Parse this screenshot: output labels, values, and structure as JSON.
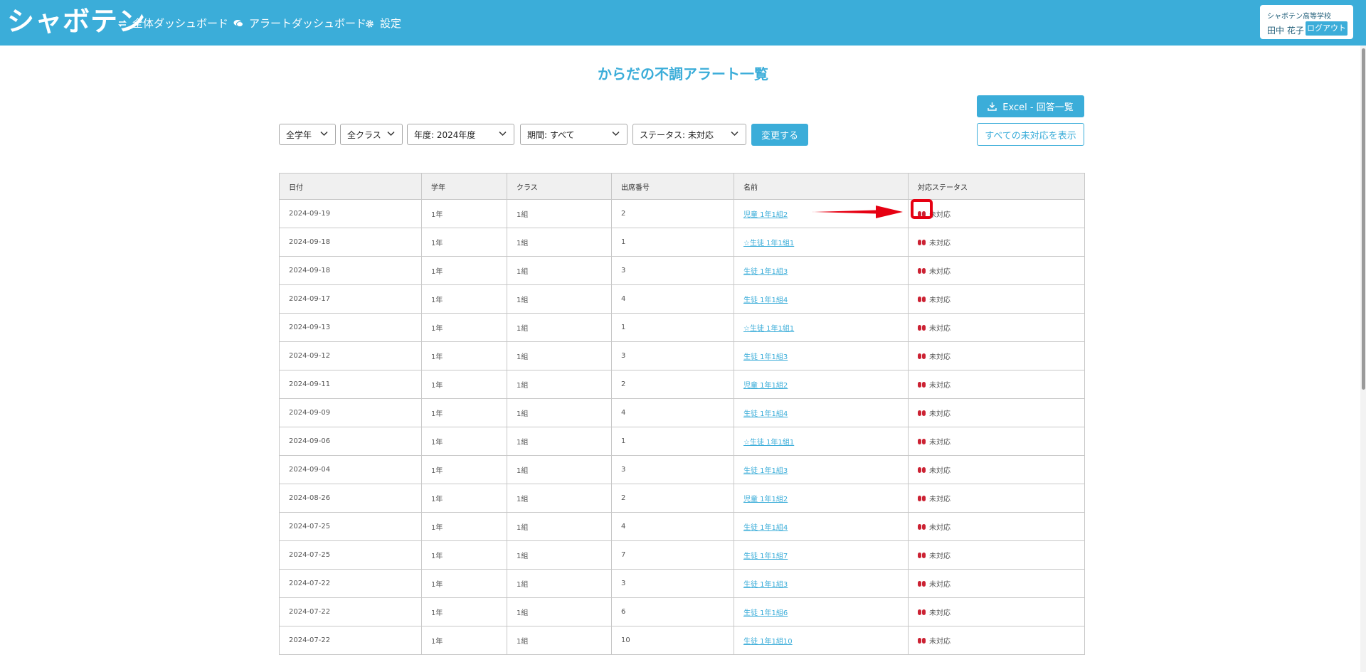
{
  "app": {
    "logo": "シャボテン"
  },
  "nav": [
    {
      "label": "全体ダッシュボード",
      "icon": "swap-icon"
    },
    {
      "label": "アラートダッシュボード",
      "icon": "chat-icon"
    },
    {
      "label": "設定",
      "icon": "gear-icon"
    }
  ],
  "user": {
    "school": "シャボテン高等学校",
    "name": "田中 花子",
    "logout_label": "ログアウト"
  },
  "page": {
    "title": "からだの不調アラート一覧"
  },
  "actions": {
    "excel_label": "Excel - 回答一覧",
    "show_all_label": "すべての未対応を表示"
  },
  "filters": {
    "grade": "全学年",
    "class": "全クラス",
    "year": "年度: 2024年度",
    "period": "期間: すべて",
    "status": "ステータス: 未対応",
    "apply_label": "変更する"
  },
  "table": {
    "headers": [
      "日付",
      "学年",
      "クラス",
      "出席番号",
      "名前",
      "対応ステータス"
    ],
    "rows": [
      [
        "2024-09-19",
        "1年",
        "1組",
        "2",
        "児童 1年1組2",
        "未対応"
      ],
      [
        "2024-09-18",
        "1年",
        "1組",
        "1",
        "☆生徒 1年1組1",
        "未対応"
      ],
      [
        "2024-09-18",
        "1年",
        "1組",
        "3",
        "生徒 1年1組3",
        "未対応"
      ],
      [
        "2024-09-17",
        "1年",
        "1組",
        "4",
        "生徒 1年1組4",
        "未対応"
      ],
      [
        "2024-09-13",
        "1年",
        "1組",
        "1",
        "☆生徒 1年1組1",
        "未対応"
      ],
      [
        "2024-09-12",
        "1年",
        "1組",
        "3",
        "生徒 1年1組3",
        "未対応"
      ],
      [
        "2024-09-11",
        "1年",
        "1組",
        "2",
        "児童 1年1組2",
        "未対応"
      ],
      [
        "2024-09-09",
        "1年",
        "1組",
        "4",
        "生徒 1年1組4",
        "未対応"
      ],
      [
        "2024-09-06",
        "1年",
        "1組",
        "1",
        "☆生徒 1年1組1",
        "未対応"
      ],
      [
        "2024-09-04",
        "1年",
        "1組",
        "3",
        "生徒 1年1組3",
        "未対応"
      ],
      [
        "2024-08-26",
        "1年",
        "1組",
        "2",
        "児童 1年1組2",
        "未対応"
      ],
      [
        "2024-07-25",
        "1年",
        "1組",
        "4",
        "生徒 1年1組4",
        "未対応"
      ],
      [
        "2024-07-25",
        "1年",
        "1組",
        "7",
        "生徒 1年1組7",
        "未対応"
      ],
      [
        "2024-07-22",
        "1年",
        "1組",
        "3",
        "生徒 1年1組3",
        "未対応"
      ],
      [
        "2024-07-22",
        "1年",
        "1組",
        "6",
        "生徒 1年1組6",
        "未対応"
      ],
      [
        "2024-07-22",
        "1年",
        "1組",
        "10",
        "生徒 1年1組10",
        "未対応"
      ]
    ]
  },
  "colors": {
    "accent": "#3badd9",
    "alert": "#cc2233",
    "annotation": "#e60012"
  }
}
